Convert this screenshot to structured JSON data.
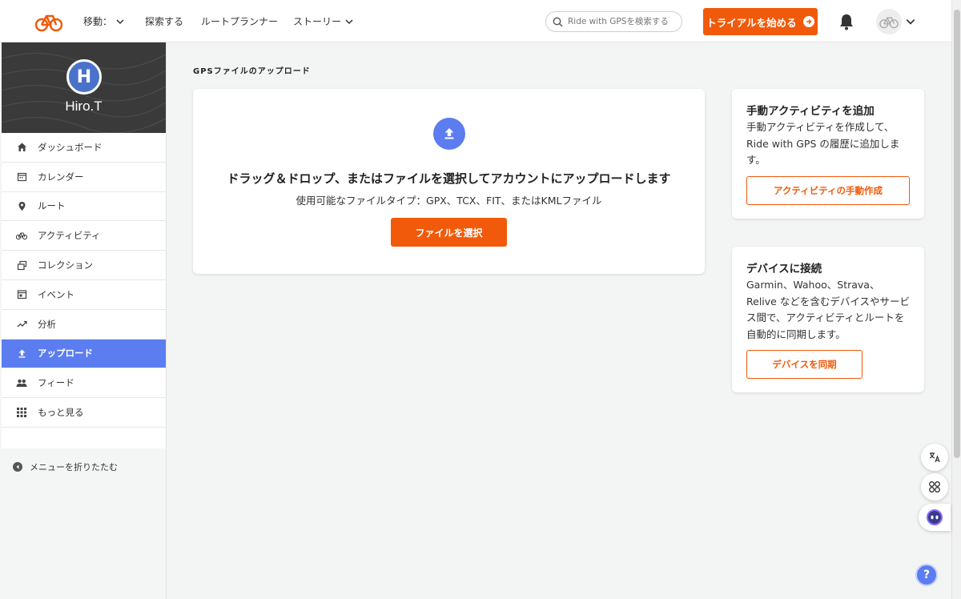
{
  "nav": {
    "move_label": "移動：",
    "explore_label": "探索する",
    "route_planner_label": "ルートプランナー",
    "stories_label": "ストーリー",
    "search_placeholder": "Ride with GPSを検索する",
    "trial_label": "トライアルを始める"
  },
  "profile": {
    "initial": "H",
    "name": "Hiro.T"
  },
  "sidebar": {
    "items": [
      {
        "label": "ダッシュボード",
        "icon": "home-icon"
      },
      {
        "label": "カレンダー",
        "icon": "calendar-icon"
      },
      {
        "label": "ルート",
        "icon": "map-pin-icon"
      },
      {
        "label": "アクティビティ",
        "icon": "bicycle-icon"
      },
      {
        "label": "コレクション",
        "icon": "collection-icon"
      },
      {
        "label": "イベント",
        "icon": "event-icon"
      },
      {
        "label": "分析",
        "icon": "trend-icon"
      },
      {
        "label": "アップロード",
        "icon": "upload-icon",
        "active": true
      },
      {
        "label": "フィード",
        "icon": "people-icon"
      },
      {
        "label": "もっと見る",
        "icon": "grid-icon"
      }
    ],
    "collapse_label": "メニューを折りたたむ"
  },
  "main": {
    "page_title": "GPSファイルのアップロード",
    "upload_heading": "ドラッグ＆ドロップ、またはファイルを選択してアカウントにアップロードします",
    "upload_sub": "使用可能なファイルタイプ：GPX、TCX、FIT、またはKMLファイル",
    "choose_file_label": "ファイルを選択"
  },
  "manual_card": {
    "title": "手動アクティビティを追加",
    "body": "手動アクティビティを作成して、Ride with GPS の履歴に追加します。",
    "button": "アクティビティの手動作成"
  },
  "device_card": {
    "title": "デバイスに接続",
    "body": "Garmin、Wahoo、Strava、Relive などを含むデバイスやサービス間で、アクティビティとルートを自動的に同期します。",
    "button": "デバイスを同期"
  },
  "floating": {
    "help_label": "?"
  },
  "colors": {
    "brand_orange": "#f15a0a",
    "accent_blue": "#5b7df0"
  }
}
